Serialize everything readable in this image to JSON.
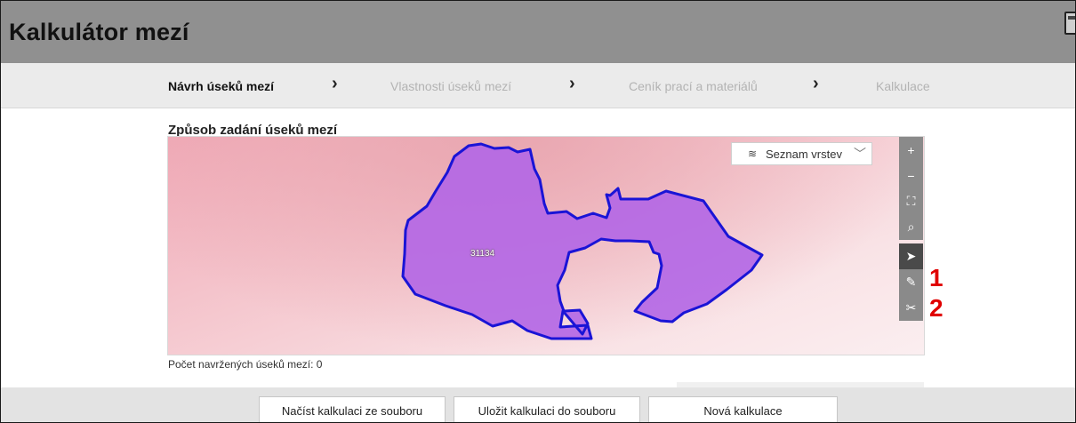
{
  "app": {
    "title": "Kalkulátor mezí"
  },
  "steps": [
    {
      "label": "Návrh úseků mezí",
      "active": true
    },
    {
      "label": "Vlastnosti úseků mezí",
      "active": false
    },
    {
      "label": "Ceník prací a materiálů",
      "active": false
    },
    {
      "label": "Kalkulace",
      "active": false
    }
  ],
  "step_separator": "›",
  "section": {
    "title": "Způsob zadání úseků mezí"
  },
  "map": {
    "parcel_label": "31134",
    "layers_button": {
      "label": "Seznam vrstev",
      "icon": "layers-icon",
      "dropdown_icon": "chevron-down-icon"
    },
    "tools": {
      "zoom_in": "+",
      "zoom_out": "−",
      "extent": "⛶",
      "search": "⌕",
      "select": "➤",
      "draw": "✎",
      "edit": "✂"
    },
    "annotations": [
      "1",
      "2"
    ],
    "colors": {
      "parcel_fill": "#b266e6",
      "parcel_stroke": "#1a14d6"
    }
  },
  "status": {
    "count_text": "Počet navržených úseků mezí: 0"
  },
  "footer": {
    "load_button": "Načíst kalkulaci ze souboru",
    "save_button": "Uložit kalkulaci do souboru",
    "new_button": "Nová kalkulace"
  }
}
